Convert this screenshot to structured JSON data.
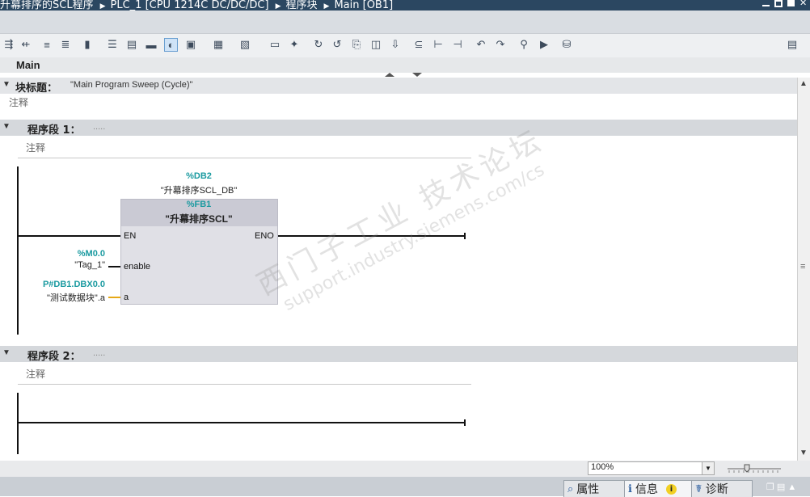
{
  "titlebar": {
    "project": "升幕排序的SCL程序",
    "device": "PLC_1 [CPU 1214C DC/DC/DC]",
    "folder": "程序块",
    "block": "Main [OB1]"
  },
  "editor": {
    "block_name": "Main",
    "block_title_label": "块标题：",
    "block_title_value": "\"Main Program Sweep (Cycle)\"",
    "block_comment": "注释",
    "networks": [
      {
        "label": "程序段 1：",
        "title": ".....",
        "comment": "注释",
        "instance_db_addr": "%DB2",
        "instance_db_name": "\"升幕排序SCL_DB\"",
        "fb_addr": "%FB1",
        "fb_name": "\"升幕排序SCL\"",
        "pin_en": "EN",
        "pin_eno": "ENO",
        "pin_enable": "enable",
        "pin_a": "a",
        "enable_addr": "%M0.0",
        "enable_tag": "\"Tag_1\"",
        "a_addr": "P#DB1.DBX0.0",
        "a_tag": "\"测试数据块\".a"
      },
      {
        "label": "程序段 2：",
        "title": ".....",
        "comment": "注释"
      }
    ]
  },
  "watermark": {
    "line1": "西门子工业  技术论坛",
    "line2": "support.industry.siemens.com/cs"
  },
  "status": {
    "zoom": "100%"
  },
  "bottom_tabs": {
    "properties": "属性",
    "info": "信息",
    "diagnostics": "诊断"
  },
  "colors": {
    "titlebar": "#2b4761",
    "network_header": "#d5d8dc",
    "address_teal": "#1a9aa0",
    "fb_box": "#e0e0e6"
  }
}
